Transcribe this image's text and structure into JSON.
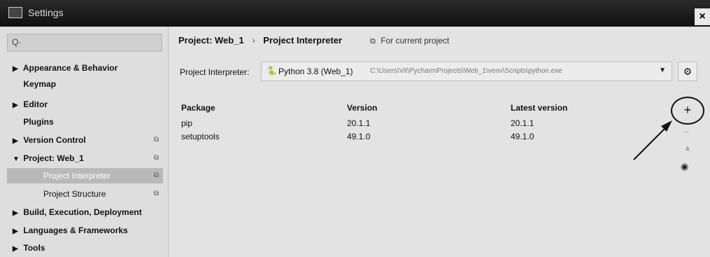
{
  "window": {
    "title": "Settings",
    "close_label": "×"
  },
  "sidebar": {
    "search_icon": "Q·",
    "items": [
      {
        "label": "Appearance & Behavior",
        "expander": "▶"
      },
      {
        "label": "Keymap",
        "expander": ""
      },
      {
        "label": "Editor",
        "expander": "▶"
      },
      {
        "label": "Plugins",
        "expander": ""
      },
      {
        "label": "Version Control",
        "expander": "▶",
        "badge": "⧉"
      },
      {
        "label": "Project: Web_1",
        "expander": "▼",
        "badge": "⧉"
      },
      {
        "label": "Project Interpreter",
        "expander": "",
        "badge": "⧉"
      },
      {
        "label": "Project Structure",
        "expander": "",
        "badge": "⧉"
      },
      {
        "label": "Build, Execution, Deployment",
        "expander": "▶"
      },
      {
        "label": "Languages & Frameworks",
        "expander": "▶"
      },
      {
        "label": "Tools",
        "expander": "▶"
      }
    ]
  },
  "header": {
    "breadcrumb_project": "Project: Web_1",
    "breadcrumb_sep": "›",
    "breadcrumb_page": "Project Interpreter",
    "for_current_project": "For current project"
  },
  "interpreter": {
    "label": "Project Interpreter:",
    "value": "Python 3.8 (Web_1)",
    "path": "C:\\Users\\Vit\\PycharmProjects\\Web_1\\venv\\Scripts\\python.exe"
  },
  "packages": {
    "columns": [
      "Package",
      "Version",
      "Latest version"
    ],
    "rows": [
      [
        "pip",
        "20.1.1",
        "20.1.1"
      ],
      [
        "setuptools",
        "49.1.0",
        "49.1.0"
      ]
    ]
  },
  "tools": {
    "add": "+",
    "remove": "−",
    "upgrade": "▲",
    "show": "◉"
  },
  "icons": {
    "gear": "gear-icon",
    "python": "python-icon",
    "settings": "settings-app-icon"
  }
}
